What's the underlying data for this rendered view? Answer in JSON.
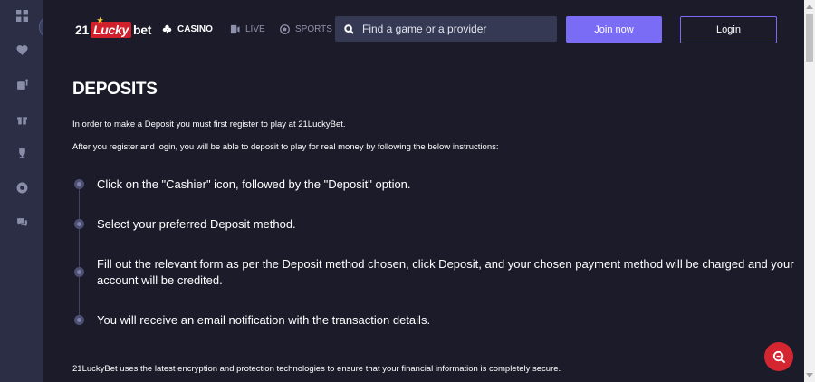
{
  "brand": {
    "logo_prefix": "21",
    "logo_highlight": "Lucky",
    "logo_suffix": "bet"
  },
  "nav": {
    "casino": "CASINO",
    "live": "LIVE",
    "sports": "SPORTS"
  },
  "search": {
    "placeholder": "Find a game or a provider"
  },
  "auth": {
    "join_label": "Join now",
    "login_label": "Login"
  },
  "rail_icons": [
    "grid-icon",
    "heart-icon",
    "slot-machine-icon",
    "gift-icon",
    "trophy-icon",
    "chip-icon",
    "chat-icon"
  ],
  "page": {
    "title": "DEPOSITS",
    "intro_1": "In order to make a Deposit you must first register to play at 21LuckyBet.",
    "intro_2": "After you register and login, you will be able to deposit to play for real money by following the below instructions:",
    "steps": [
      "Click on the \"Cashier\" icon, followed by the \"Deposit\" option.",
      "Select your preferred Deposit method.",
      "Fill out the relevant form as per the Deposit method chosen, click Deposit, and your chosen payment method will be charged and your account will be credited.",
      "You will receive an email notification with the transaction details."
    ],
    "footer_note": "21LuckyBet uses the latest encryption and protection technologies to ensure that your financial information is completely secure."
  },
  "colors": {
    "background": "#1b1b2a",
    "rail": "#2b2e45",
    "accent": "#7b6cf6",
    "brand_red": "#d0202c",
    "help_bubble": "#d42630"
  }
}
